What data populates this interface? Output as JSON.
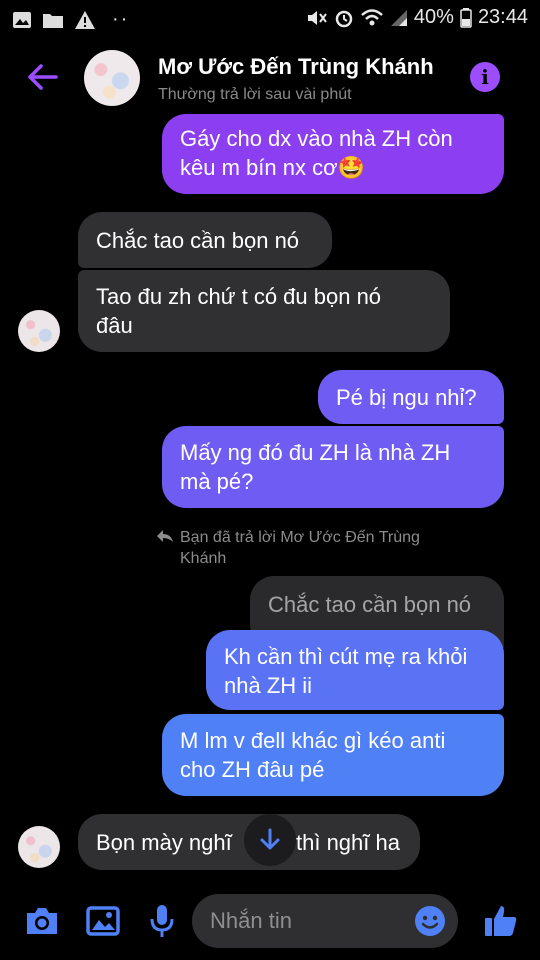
{
  "status_bar": {
    "battery": "40%",
    "time": "23:44",
    "notif_dots": "··"
  },
  "header": {
    "name": "Mơ Ước Đến Trùng Khánh",
    "status": "Thường trả lời sau vài phút",
    "info_glyph": "i"
  },
  "messages": [
    {
      "from": "me",
      "line1": "Gáy cho dx vào nhà ZH còn",
      "line2": "kêu m bín nx cơ",
      "emoji": "🤩"
    },
    {
      "from": "them",
      "text": "Chắc tao cần bọn nó"
    },
    {
      "from": "them",
      "line1": "Tao đu zh chứ t có đu bọn nó",
      "line2": "đâu"
    },
    {
      "from": "me",
      "text": "Pé bị ngu nhỉ?"
    },
    {
      "from": "me",
      "line1": "Mấy ng đó đu ZH là nhà ZH",
      "line2": "mà pé?"
    },
    {
      "reply_note_line1": "Bạn đã trả lời Mơ Ước Đến Trùng",
      "reply_note_line2": "Khánh"
    },
    {
      "quoted": "Chắc tao cần bọn nó"
    },
    {
      "from": "me",
      "line1": "Kh cần thì cút mẹ ra khỏi",
      "line2": "nhà ZH ii"
    },
    {
      "from": "me",
      "line1": "M lm v đell khác gì kéo anti",
      "line2": "cho ZH đâu pé"
    },
    {
      "from": "them",
      "left": "Bọn mày nghĩ",
      "right": "thì nghĩ ha"
    }
  ],
  "composer": {
    "placeholder": "Nhắn tin"
  },
  "colors": {
    "accent": "#9b4dff",
    "bubble_purple": "#8b3ff0",
    "bubble_blue": "#4f80f5",
    "incoming": "#303033"
  }
}
